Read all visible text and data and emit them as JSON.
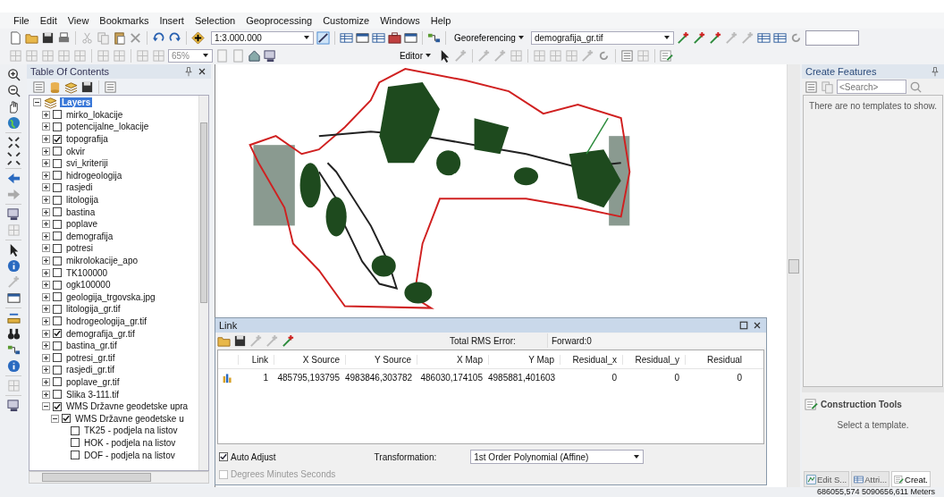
{
  "menu": [
    "File",
    "Edit",
    "View",
    "Bookmarks",
    "Insert",
    "Selection",
    "Geoprocessing",
    "Customize",
    "Windows",
    "Help"
  ],
  "toolbar": {
    "scale": "1:3.000.000",
    "georeferencing": "Georeferencing",
    "layer": "demografija_gr.tif",
    "zoom": "65%",
    "editor": "Editor"
  },
  "toc": {
    "title": "Table Of Contents",
    "root": {
      "label": "Layers",
      "expanded": true,
      "selected": true,
      "children": [
        {
          "label": "mirko_lokacije",
          "checked": false,
          "expanded": false
        },
        {
          "label": "potencijalne_lokacije",
          "checked": false,
          "expanded": false
        },
        {
          "label": "topografija",
          "checked": true,
          "expanded": false
        },
        {
          "label": "okvir",
          "checked": false,
          "expanded": false
        },
        {
          "label": "svi_kriteriji",
          "checked": false,
          "expanded": false
        },
        {
          "label": "hidrogeologija",
          "checked": false,
          "expanded": false
        },
        {
          "label": "rasjedi",
          "checked": false,
          "expanded": false
        },
        {
          "label": "litologija",
          "checked": false,
          "expanded": false
        },
        {
          "label": "bastina",
          "checked": false,
          "expanded": false
        },
        {
          "label": "poplave",
          "checked": false,
          "expanded": false
        },
        {
          "label": "demografija",
          "checked": false,
          "expanded": false
        },
        {
          "label": "potresi",
          "checked": false,
          "expanded": false
        },
        {
          "label": "mikrolokacije_apo",
          "checked": false,
          "expanded": false
        },
        {
          "label": "TK100000",
          "checked": false,
          "expanded": false
        },
        {
          "label": "ogk100000",
          "checked": false,
          "expanded": false
        },
        {
          "label": "geologija_trgovska.jpg",
          "checked": false,
          "expanded": false
        },
        {
          "label": "litologija_gr.tif",
          "checked": false,
          "expanded": false
        },
        {
          "label": "hodrogeologija_gr.tif",
          "checked": false,
          "expanded": false
        },
        {
          "label": "demografija_gr.tif",
          "checked": true,
          "expanded": false
        },
        {
          "label": "bastina_gr.tif",
          "checked": false,
          "expanded": false
        },
        {
          "label": "potresi_gr.tif",
          "checked": false,
          "expanded": false
        },
        {
          "label": "rasjedi_gr.tif",
          "checked": false,
          "expanded": false
        },
        {
          "label": "poplave_gr.tif",
          "checked": false,
          "expanded": false
        },
        {
          "label": "Slika 3-111.tif",
          "checked": false,
          "expanded": false
        },
        {
          "label": "WMS Državne geodetske upra",
          "checked": true,
          "expanded": true,
          "children": [
            {
              "label": "WMS Državne geodetske u",
              "checked": true,
              "expanded": true,
              "children": [
                {
                  "label": "TK25 - podjela na listov",
                  "checked": false
                },
                {
                  "label": "HOK - podjela na listov",
                  "checked": false
                },
                {
                  "label": "DOF - podjela na listov",
                  "checked": false
                }
              ]
            }
          ]
        }
      ]
    }
  },
  "link_window": {
    "title": "Link",
    "rms_label": "Total RMS Error:",
    "rms_value": "Forward:0",
    "columns": [
      "Link",
      "X Source",
      "Y Source",
      "X Map",
      "Y Map",
      "Residual_x",
      "Residual_y",
      "Residual"
    ],
    "rows": [
      {
        "cells": [
          "1",
          "485795,193795",
          "4983846,303782",
          "486030,174105",
          "4985881,401603",
          "0",
          "0",
          "0"
        ]
      }
    ],
    "auto_adjust": {
      "label": "Auto Adjust",
      "checked": true,
      "disabled": false
    },
    "dms": {
      "label": "Degrees Minutes Seconds",
      "checked": false,
      "disabled": true
    },
    "transformation_label": "Transformation:",
    "transformation": "1st Order Polynomial (Affine)"
  },
  "create_features": {
    "title": "Create Features",
    "search_placeholder": "<Search>",
    "empty_text": "There are no templates to show.",
    "construction_title": "Construction Tools",
    "construction_text": "Select a template.",
    "tabs": [
      {
        "label": "Edit S...",
        "selected": false
      },
      {
        "label": "Attri...",
        "selected": false
      },
      {
        "label": "Creat.",
        "selected": true
      }
    ]
  },
  "status_bar": {
    "coordinates": "686055,574  5090656,611 Meters"
  }
}
